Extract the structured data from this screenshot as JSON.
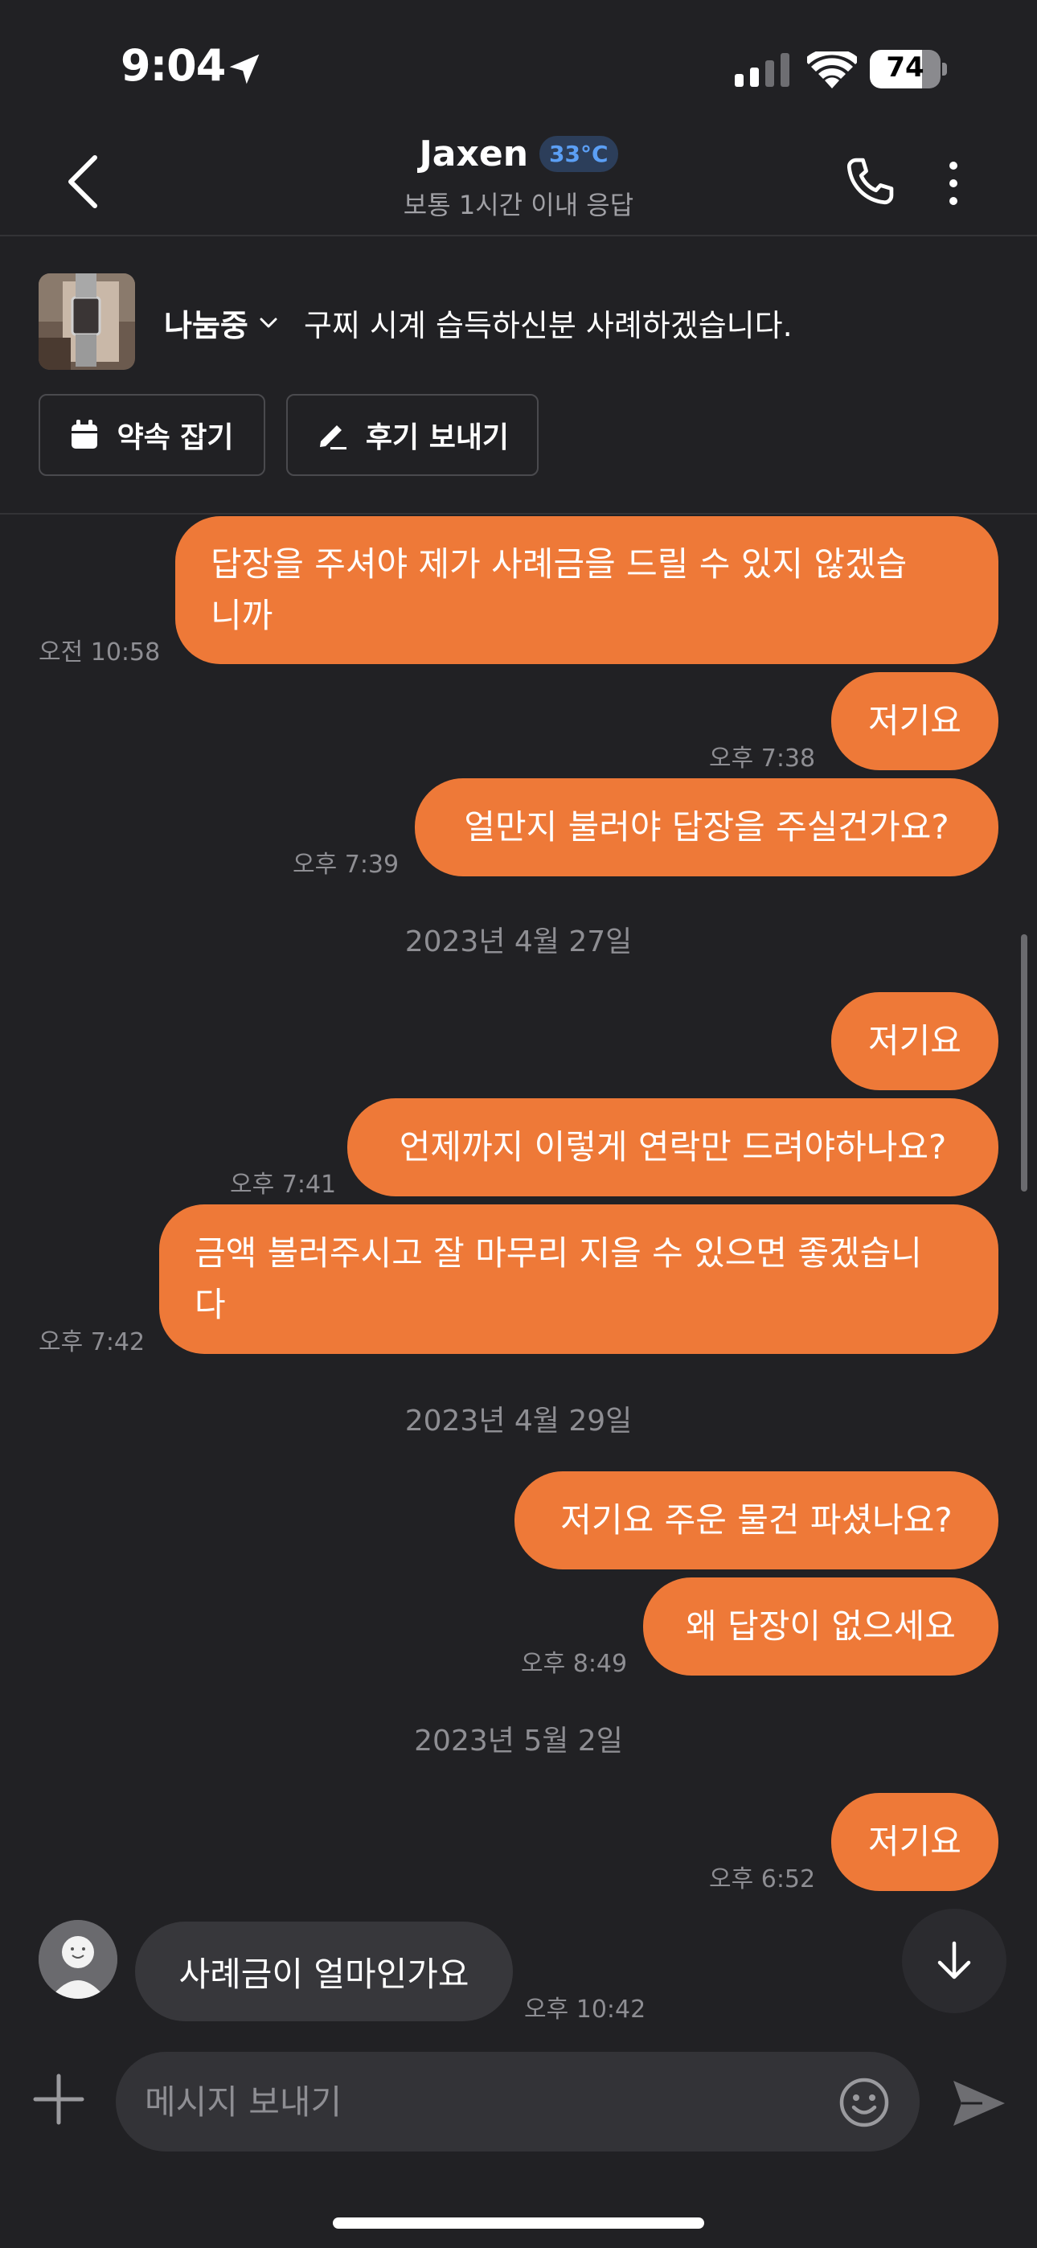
{
  "status_bar": {
    "time": "9:04",
    "battery": "74",
    "battery_level": 0.74
  },
  "header": {
    "name": "Jaxen",
    "temperature": "33°C",
    "response_time": "보통 1시간 이내 응답",
    "icons": [
      "chevron-left-icon",
      "phone-icon",
      "more-vertical-icon"
    ]
  },
  "product": {
    "status": "나눔중",
    "title": "구찌 시계 습득하신분 사례하겠습니다.",
    "buttons": {
      "promise": "약속 잡기",
      "review": "후기 보내기"
    }
  },
  "messages": [
    {
      "type": "sent",
      "lines": [
        "답장을 주셔야 제가 사례금을 드릴 수 있지 않겠습",
        "니까"
      ],
      "time": "오전 10:58"
    },
    {
      "type": "sent",
      "text": "저기요",
      "time": "오후 7:38"
    },
    {
      "type": "sent",
      "text": "얼만지 불러야 답장을 주실건가요?",
      "time": "오후 7:39"
    },
    {
      "type": "date",
      "text": "2023년 4월 27일"
    },
    {
      "type": "sent",
      "text": "저기요",
      "time": ""
    },
    {
      "type": "sent",
      "text": "언제까지 이렇게 연락만 드려야하나요?",
      "time": "오후 7:41"
    },
    {
      "type": "sent",
      "lines": [
        "금액 불러주시고 잘 마무리 지을 수 있으면 좋겠습니",
        "다"
      ],
      "time": "오후 7:42"
    },
    {
      "type": "date",
      "text": "2023년 4월 29일"
    },
    {
      "type": "sent",
      "text": "저기요 주운 물건 파셨나요?",
      "time": ""
    },
    {
      "type": "sent",
      "text": "왜 답장이 없으세요",
      "time": "오후 8:49"
    },
    {
      "type": "date",
      "text": "2023년 5월 2일"
    },
    {
      "type": "sent",
      "text": "저기요",
      "time": "오후 6:52"
    },
    {
      "type": "received",
      "text": "사례금이 얼마인가요",
      "time": "오후 10:42"
    }
  ],
  "input": {
    "placeholder": "메시지 보내기"
  },
  "colors": {
    "background": "#212124",
    "sent_bubble": "#ee7938",
    "received_bubble": "#37373b",
    "temperature_badge": "#5b9ff5"
  }
}
